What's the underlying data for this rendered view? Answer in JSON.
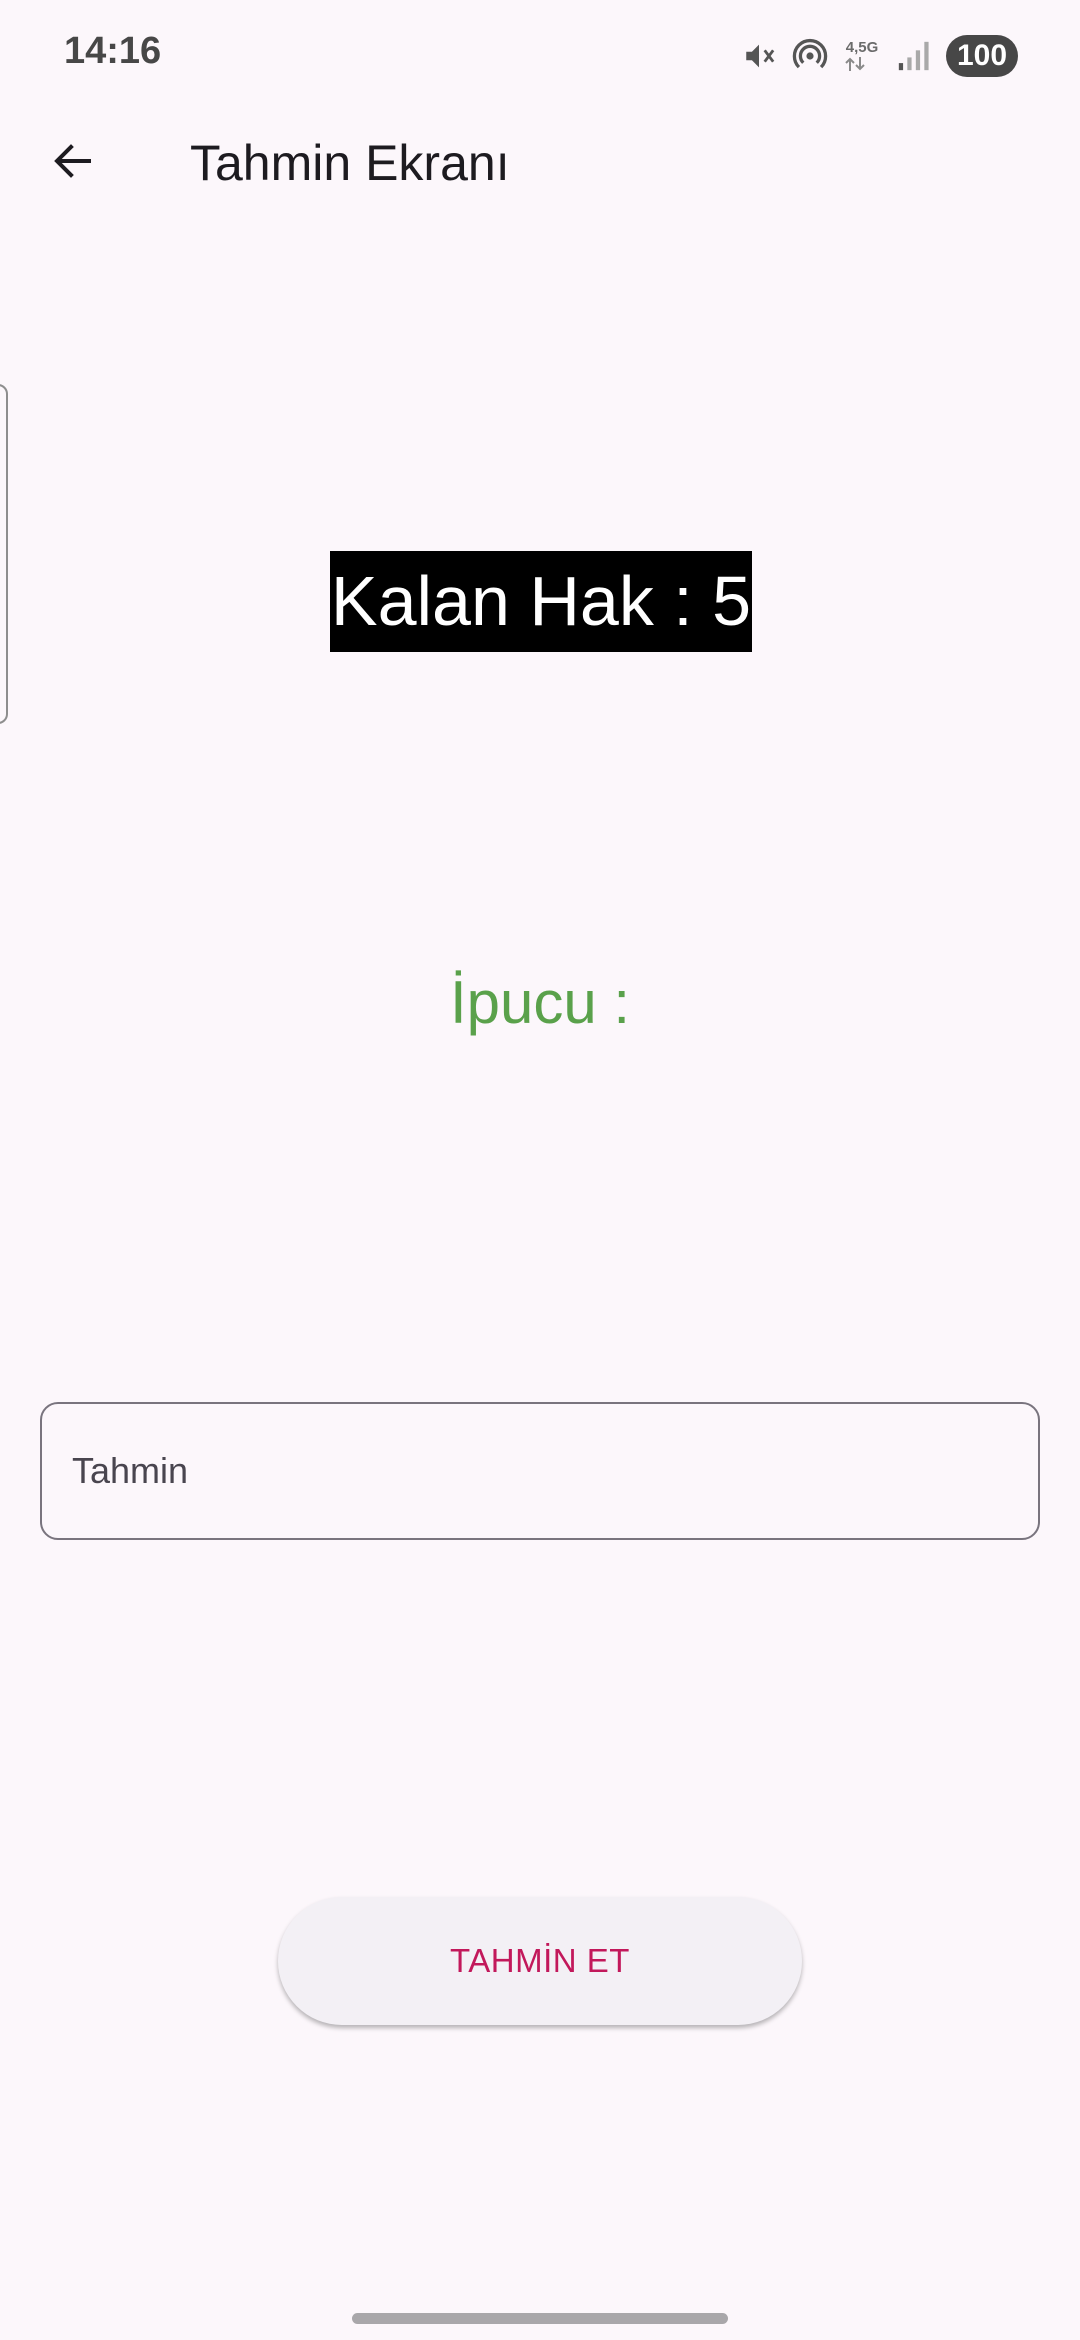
{
  "status_bar": {
    "time": "14:16",
    "network_label": "4,5G",
    "battery": "100",
    "icons": [
      "mute-icon",
      "hotspot-icon",
      "network-4.5g-icon",
      "signal-icon",
      "battery-icon"
    ]
  },
  "app_bar": {
    "title": "Tahmin Ekranı",
    "back_icon": "arrow-left-icon"
  },
  "main": {
    "attempts_label": "Kalan Hak : 5",
    "hint_label": "İpucu :",
    "guess_placeholder": "Tahmin",
    "guess_value": "",
    "submit_label": "TAHMİN ET"
  },
  "colors": {
    "background": "#fcf7fb",
    "hint": "#5aa14b",
    "button_text": "#c2185b",
    "attempts_bg": "#000000"
  }
}
